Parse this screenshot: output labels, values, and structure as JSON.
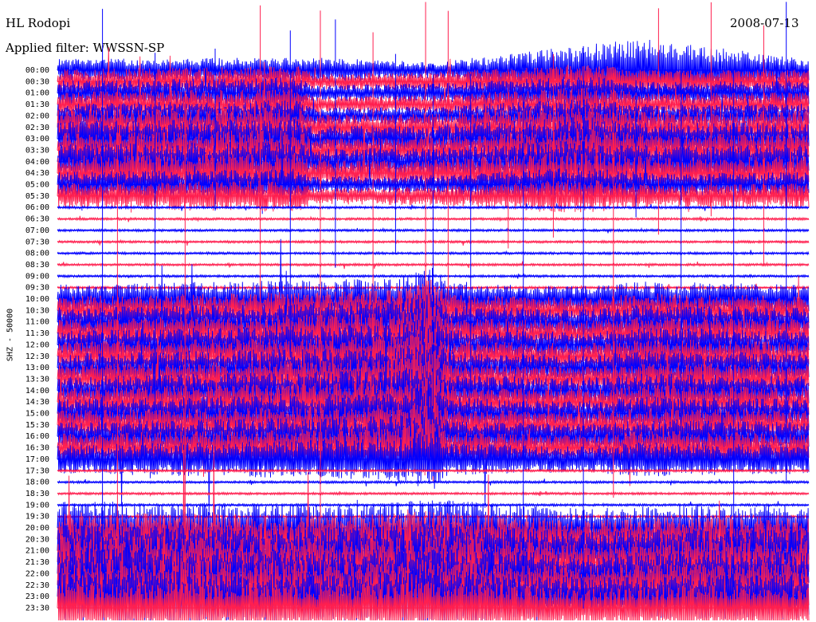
{
  "header": {
    "station": "HL Rodopi",
    "date": "2008-07-13",
    "filter": "Applied filter: WWSSN-SP"
  },
  "colors": {
    "trace_a": "#0000ff",
    "trace_b": "#ff1f4f",
    "background": "#ffffff",
    "text": "#000000"
  },
  "chart_data": {
    "type": "line",
    "ylabel": "SHZ - 50000",
    "row_labels": [
      "00:00",
      "00:30",
      "01:00",
      "01:30",
      "02:00",
      "02:30",
      "03:00",
      "03:30",
      "04:00",
      "04:30",
      "05:00",
      "05:30",
      "06:00",
      "06:30",
      "07:00",
      "07:30",
      "08:00",
      "08:30",
      "09:00",
      "09:30",
      "10:00",
      "10:30",
      "11:00",
      "11:30",
      "12:00",
      "12:30",
      "13:00",
      "13:30",
      "14:00",
      "14:30",
      "15:00",
      "15:30",
      "16:00",
      "16:30",
      "17:00",
      "17:30",
      "18:00",
      "18:30",
      "19:00",
      "19:30",
      "20:00",
      "20:30",
      "21:00",
      "21:30",
      "22:00",
      "22:30",
      "23:00",
      "23:30"
    ],
    "row_colors": "alternating blue / red",
    "grid": false,
    "legend": "none"
  }
}
